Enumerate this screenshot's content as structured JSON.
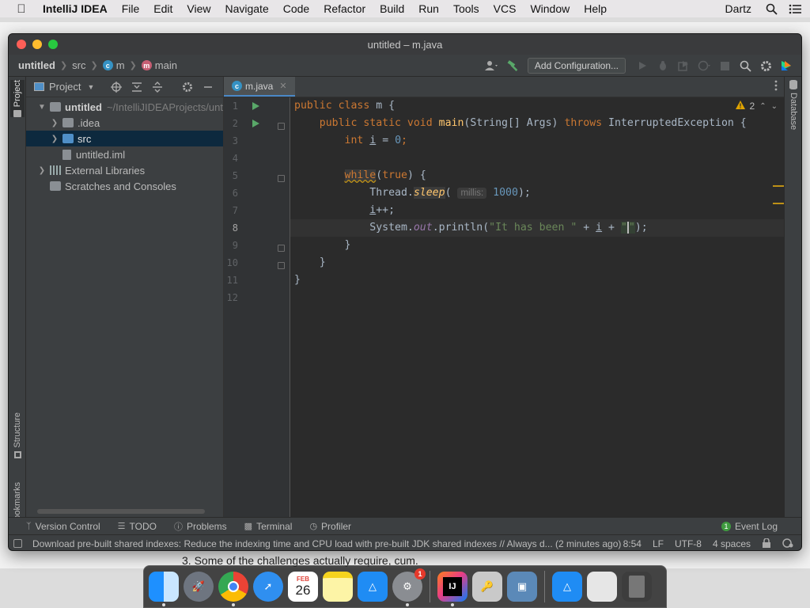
{
  "menubar": {
    "app": "IntelliJ IDEA",
    "items": [
      "File",
      "Edit",
      "View",
      "Navigate",
      "Code",
      "Refactor",
      "Build",
      "Run",
      "Tools",
      "VCS",
      "Window",
      "Help"
    ],
    "user": "Dartz"
  },
  "window": {
    "title": "untitled – m.java"
  },
  "breadcrumb": {
    "project": "untitled",
    "src": "src",
    "cls": "m",
    "method": "main"
  },
  "toolbar": {
    "add_configuration": "Add Configuration..."
  },
  "left_tabs": {
    "project": "Project",
    "structure": "Structure",
    "bookmarks": "Bookmarks"
  },
  "right_tabs": {
    "database": "Database"
  },
  "project_panel": {
    "title": "Project",
    "tree": {
      "root": "untitled",
      "root_path": "~/IntelliJIDEAProjects/unt",
      "idea": ".idea",
      "src": "src",
      "iml": "untitled.iml",
      "libs": "External Libraries",
      "scratches": "Scratches and Consoles"
    }
  },
  "editor": {
    "tab": "m.java",
    "warnings": "2",
    "line_numbers": [
      "1",
      "2",
      "3",
      "4",
      "5",
      "6",
      "7",
      "8",
      "9",
      "10",
      "11",
      "12"
    ],
    "code": {
      "l1_kw": "public class",
      "l1_rest": " m {",
      "l2_kw1": "public static void",
      "l2_fn": "main",
      "l2_mid": "(String[] Args) ",
      "l2_kw2": "throws",
      "l2_rest": " InterruptedException {",
      "l3_kw": "int",
      "l3_var": "i",
      "l3_eq": " = ",
      "l3_num": "0",
      "l3_end": ";",
      "l5_kw": "while",
      "l5_paren": "(",
      "l5_true": "true",
      "l5_rest": ") {",
      "l6_a": "Thread.",
      "l6_m": "sleep",
      "l6_p": "(",
      "l6_hint": "millis:",
      "l6_num": "1000",
      "l6_end": ");",
      "l7_var": "i",
      "l7_rest": "++;",
      "l8_a": "System.",
      "l8_out": "out",
      "l8_b": ".println(",
      "l8_str": "\"It has been \"",
      "l8_c": " + ",
      "l8_var": "i",
      "l8_d": " + ",
      "l8_q1": "\"",
      "l8_q2": "\"",
      "l8_end": ");",
      "l9": "}",
      "l10": "}",
      "l11": "}"
    }
  },
  "bottom_tools": [
    "Version Control",
    "TODO",
    "Problems",
    "Terminal",
    "Profiler"
  ],
  "event_log": {
    "label": "Event Log",
    "count": "1"
  },
  "status": {
    "message": "Download pre-built shared indexes: Reduce the indexing time and CPU load with pre-built JDK shared indexes // Always d... (2 minutes ago)",
    "position": "8:54",
    "line_sep": "LF",
    "encoding": "UTF-8",
    "indent": "4 spaces"
  },
  "background_text": "3. Some of the challenges actually require, cum.",
  "dock": {
    "calendar_month": "FEB",
    "calendar_day": "26",
    "sysprefs_badge": "1",
    "ij_label": "IJ"
  }
}
